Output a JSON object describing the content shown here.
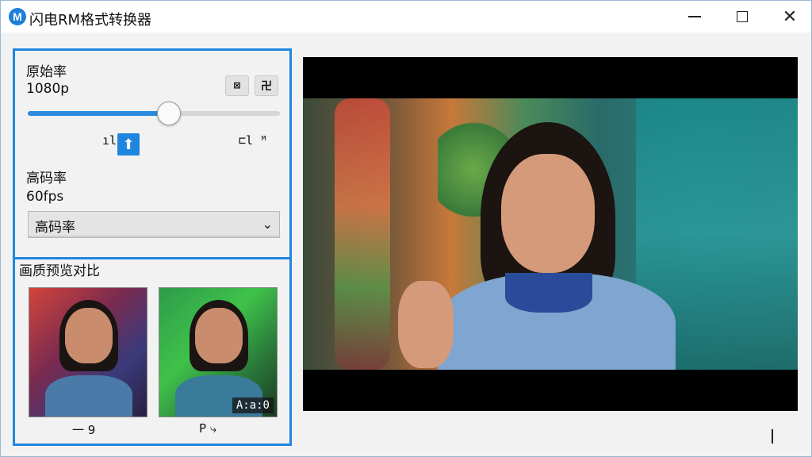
{
  "window": {
    "app_icon_letter": "M",
    "title": "闪电RM格式转换器",
    "controls": {
      "minimize_icon": "minimize-icon",
      "maximize_icon": "maximize-icon",
      "close_icon": "close-icon",
      "close_glyph": "✕"
    }
  },
  "settings": {
    "original_label": "原始率",
    "resolution_value": "1080p",
    "tool_a_glyph": "⊠",
    "tool_b_glyph": "卍",
    "slider_level_percent": 56,
    "small_left_glyph": "ıll",
    "up_glyph": "⬆",
    "small_right_glyph": "⊏l ᴹ",
    "bitrate_label": "高码率",
    "fps_value": "60fps",
    "select_value": "高码率",
    "select_arrow": "⌄"
  },
  "compare": {
    "label": "画质预览对比",
    "thumb1_caption": "一  9",
    "thumb2_caption": "P  ⤷",
    "thumb2_overlay": "A:a:0"
  },
  "colors": {
    "accent": "#1f86e0"
  }
}
